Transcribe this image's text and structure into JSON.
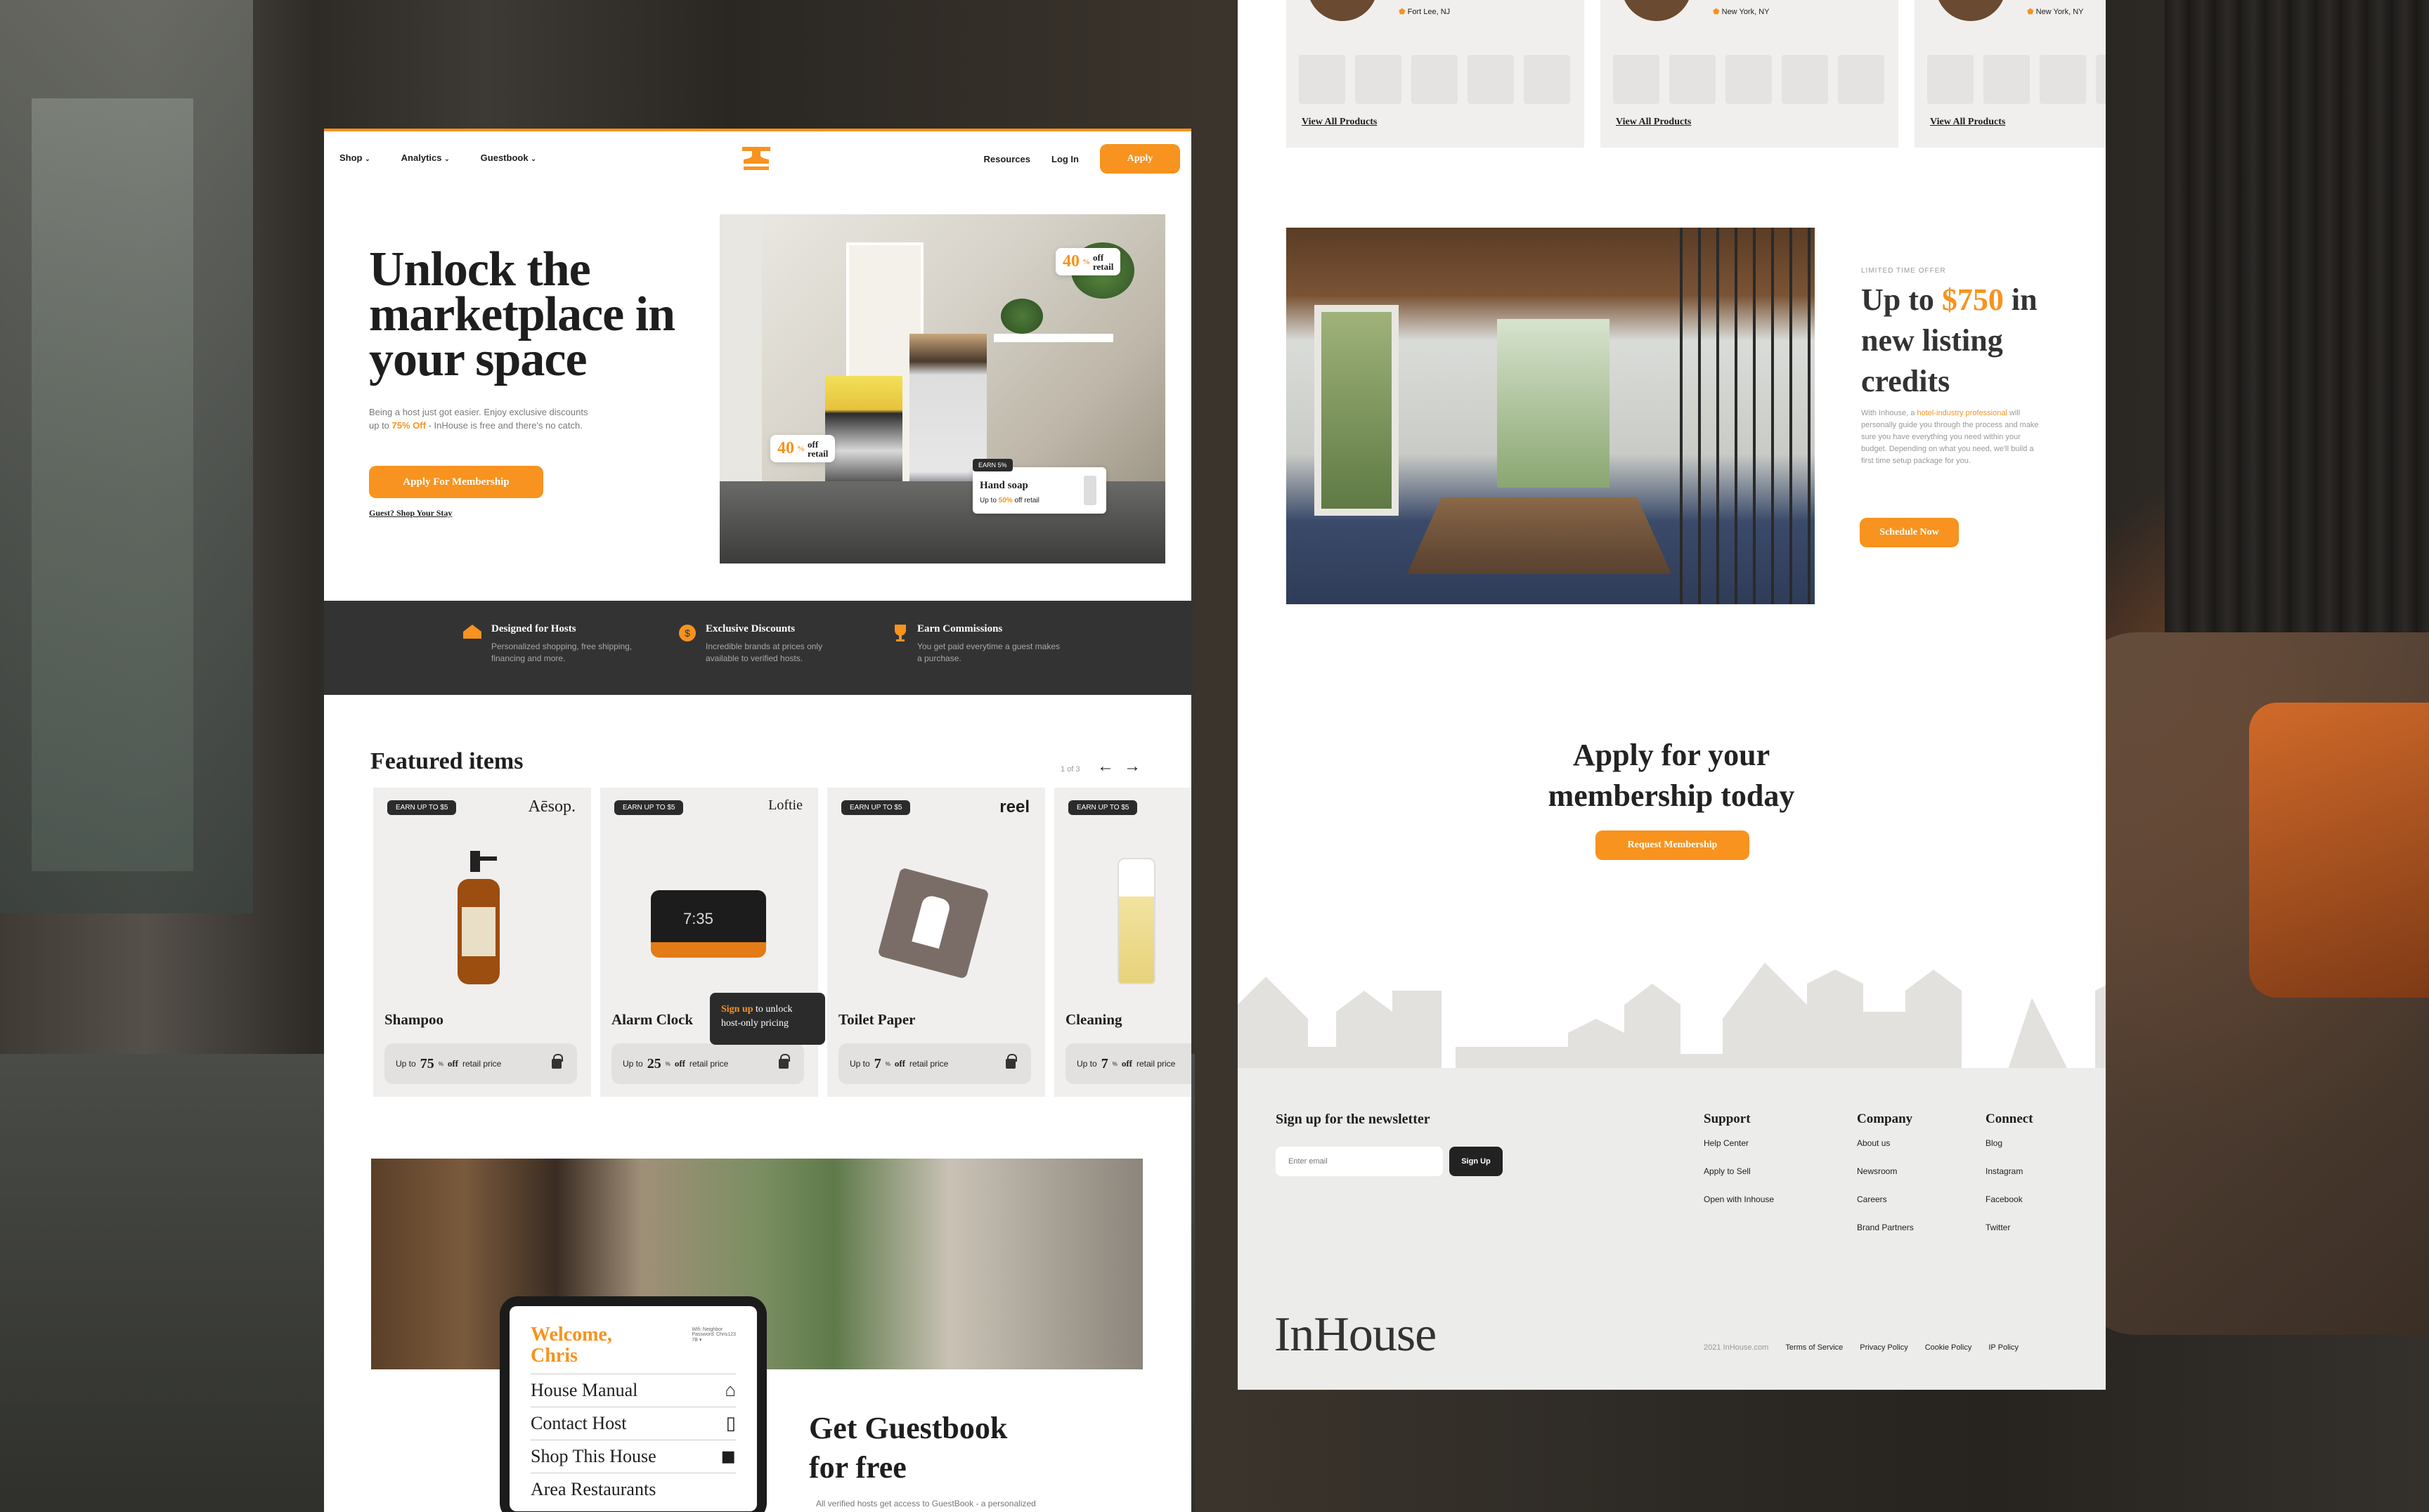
{
  "page1": {
    "nav": {
      "shop": "Shop",
      "analytics": "Analytics",
      "guestbook": "Guestbook",
      "resources": "Resources",
      "login": "Log In",
      "apply": "Apply"
    },
    "hero": {
      "title": "Unlock the marketplace in your space",
      "desc_a": "Being a host just got easier. Enjoy exclusive discounts up to ",
      "desc_highlight": "75% Off",
      "desc_b": " - InHouse is free and there's no catch.",
      "cta": "Apply For Membership",
      "link": "Guest? Shop Your Stay",
      "badge_pct": "40",
      "badge_off": "off",
      "badge_retail": "retail",
      "earn": "EARN 5%",
      "product_name": "Hand soap",
      "product_sub_a": "Up to ",
      "product_sub_pct": "50%",
      "product_sub_b": " off retail"
    },
    "features": [
      {
        "title": "Designed for Hosts",
        "desc": "Personalized shopping, free shipping, financing and more."
      },
      {
        "title": "Exclusive Discounts",
        "desc": "Incredible brands at prices only available to verified hosts."
      },
      {
        "title": "Earn Commissions",
        "desc": "You get paid everytime a guest makes a purchase."
      }
    ],
    "featured": {
      "title": "Featured items",
      "pager": "1 of 3",
      "items": [
        {
          "earn": "EARN UP TO $5",
          "brand": "Aēsop.",
          "name": "Shampoo",
          "up": "Up to",
          "pct": "75",
          "off": "off",
          "retail": "retail price"
        },
        {
          "earn": "EARN UP TO $5",
          "brand": "Loftie",
          "name": "Alarm Clock",
          "up": "Up to",
          "pct": "25",
          "off": "off",
          "retail": "retail price",
          "time": "7:35"
        },
        {
          "earn": "EARN UP TO $5",
          "brand": "reel",
          "name": "Toilet Paper",
          "up": "Up to",
          "pct": "7",
          "off": "off",
          "retail": "retail price"
        },
        {
          "earn": "EARN UP TO $5",
          "brand": "",
          "name": "Cleaning",
          "up": "Up to",
          "pct": "7",
          "off": "off",
          "retail": "retail price"
        }
      ],
      "tooltip_a": "Sign up",
      "tooltip_b": " to unlock host-only pricing"
    },
    "tablet": {
      "welcome": "Welcome, Chris",
      "wifi": "Wifi: Neighbor\nPassword: Chris123\n7B ▾",
      "items": [
        "House Manual",
        "Contact Host",
        "Shop This House",
        "Area Restaurants"
      ]
    },
    "guestbook": {
      "title": "Get Guestbook for free",
      "desc": "All verified hosts get access to GuestBook - a personalized"
    }
  },
  "page2": {
    "cards": [
      {
        "loc": "Fort Lee, NJ",
        "link": "View All Products"
      },
      {
        "loc": "New York, NY",
        "link": "View All Products"
      },
      {
        "loc": "New York, NY",
        "link": "View All Products"
      }
    ],
    "offer": {
      "eyebrow": "LIMITED TIME OFFER",
      "title_a": "Up to ",
      "title_amount": "$750",
      "title_b": " in new listing credits",
      "desc_a": "With Inhouse, a ",
      "desc_highlight": "hotel-industry professional",
      "desc_b": " will personally guide you through the process and make sure you have everything you need within your budget. Depending on what you need, we'll build a first time setup package for you.",
      "cta": "Schedule Now"
    },
    "apply": {
      "title": "Apply for your membership today",
      "cta": "Request Membership"
    },
    "footer": {
      "newsletter": "Sign up for the newsletter",
      "placeholder": "Enter email",
      "signup": "Sign Up",
      "support": {
        "title": "Support",
        "links": [
          "Help Center",
          "Apply to Sell",
          "Open with Inhouse"
        ]
      },
      "company": {
        "title": "Company",
        "links": [
          "About us",
          "Newsroom",
          "Careers",
          "Brand Partners"
        ]
      },
      "connect": {
        "title": "Connect",
        "links": [
          "Blog",
          "Instagram",
          "Facebook",
          "Twitter"
        ]
      },
      "logo": "InHouse",
      "copyright": "2021 InHouse.com",
      "legal": [
        "Terms of Service",
        "Privacy Policy",
        "Cookie Policy",
        "IP Policy"
      ]
    }
  },
  "colors": {
    "accent": "#f7931e",
    "dark": "#333333",
    "panel": "#f0efee"
  }
}
